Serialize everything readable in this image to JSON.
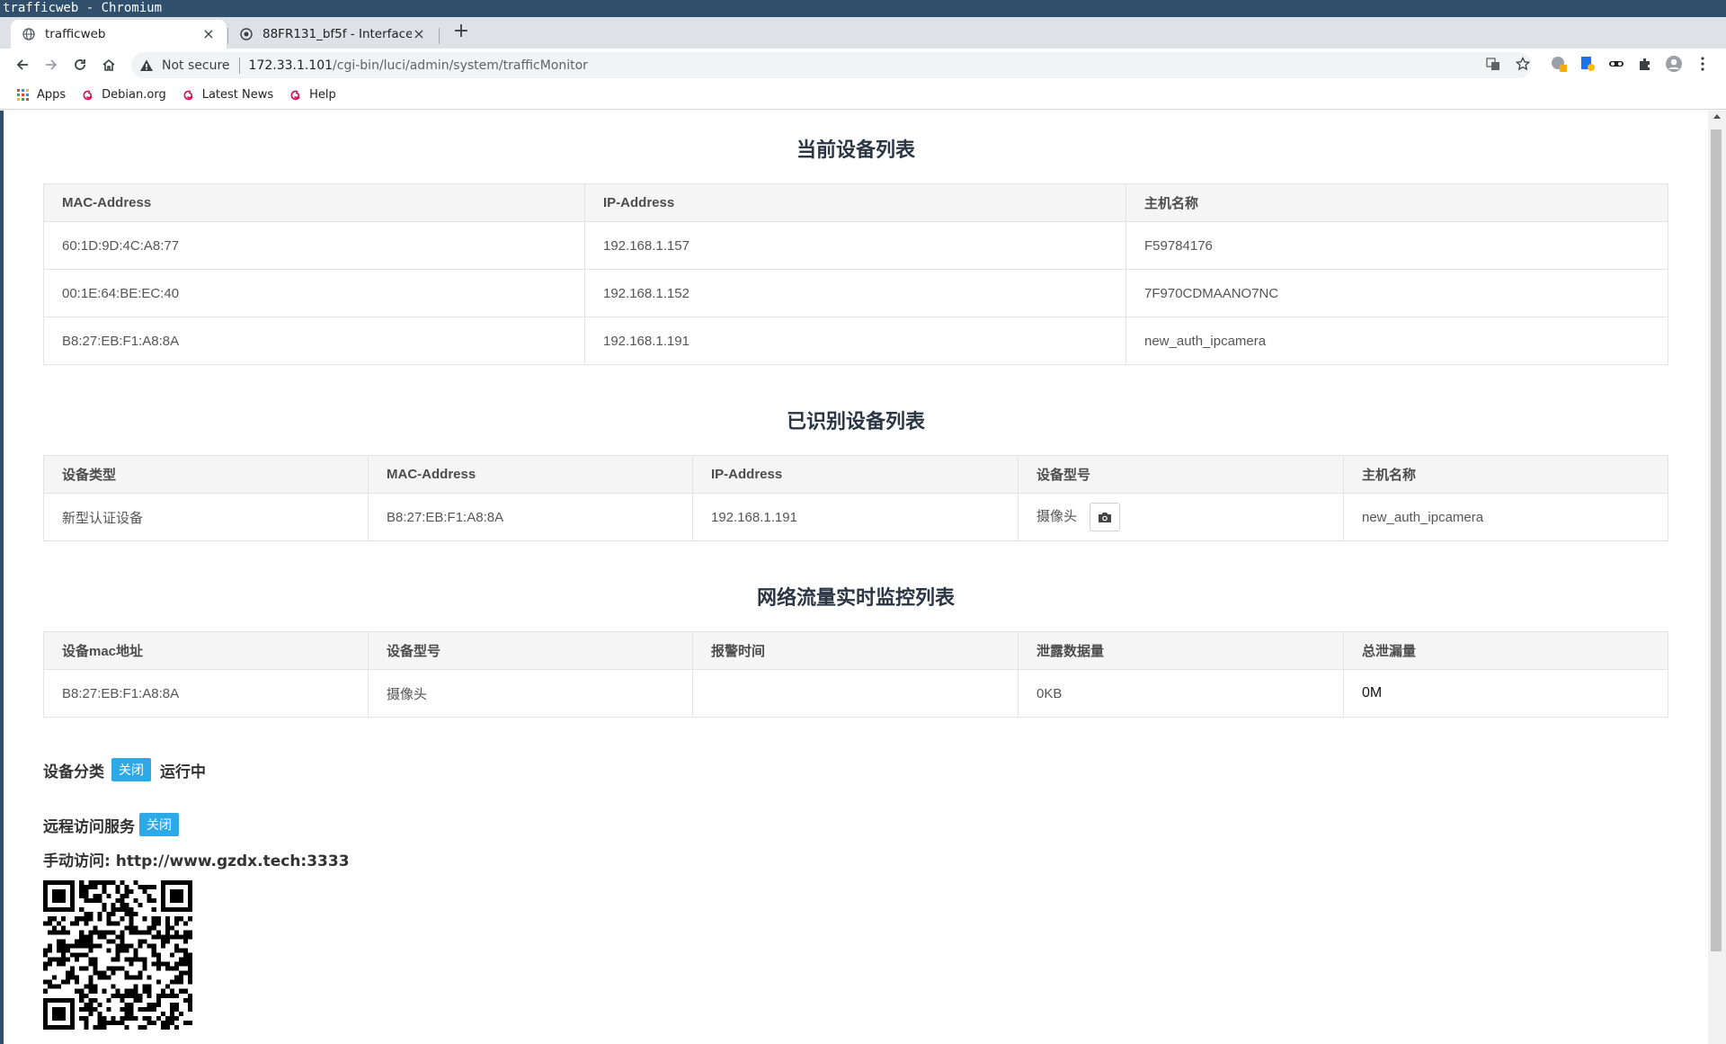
{
  "window": {
    "title": "trafficweb - Chromium"
  },
  "tabs": [
    {
      "title": "trafficweb",
      "active": true
    },
    {
      "title": "88FR131_bf5f - Interfaces",
      "active": false
    }
  ],
  "omnibox": {
    "security_text": "Not secure",
    "url_host": "172.33.1.101",
    "url_path": "/cgi-bin/luci/admin/system/trafficMonitor"
  },
  "bookmarks": [
    {
      "label": "Apps"
    },
    {
      "label": "Debian.org"
    },
    {
      "label": "Latest News"
    },
    {
      "label": "Help"
    }
  ],
  "current_devices": {
    "title": "当前设备列表",
    "headers": [
      "MAC-Address",
      "IP-Address",
      "主机名称"
    ],
    "rows": [
      [
        "60:1D:9D:4C:A8:77",
        "192.168.1.157",
        "F59784176"
      ],
      [
        "00:1E:64:BE:EC:40",
        "192.168.1.152",
        "7F970CDMAANO7NC"
      ],
      [
        "B8:27:EB:F1:A8:8A",
        "192.168.1.191",
        "new_auth_ipcamera"
      ]
    ]
  },
  "identified_devices": {
    "title": "已识别设备列表",
    "headers": [
      "设备类型",
      "MAC-Address",
      "IP-Address",
      "设备型号",
      "主机名称"
    ],
    "rows": [
      [
        "新型认证设备",
        "B8:27:EB:F1:A8:8A",
        "192.168.1.191",
        "摄像头",
        "new_auth_ipcamera"
      ]
    ]
  },
  "traffic_monitor": {
    "title": "网络流量实时监控列表",
    "headers": [
      "设备mac地址",
      "设备型号",
      "报警时间",
      "泄露数据量",
      "总泄漏量"
    ],
    "rows": [
      [
        "B8:27:EB:F1:A8:8A",
        "摄像头",
        "",
        "0KB",
        "0M"
      ]
    ]
  },
  "device_classification": {
    "label": "设备分类",
    "badge": "关闭",
    "status": "运行中"
  },
  "remote_access": {
    "label": "远程访问服务",
    "badge": "关闭",
    "manual": "手动访问: http://www.gzdx.tech:3333"
  },
  "colors": {
    "badge": "#2ea9e8",
    "titlebar": "#2f4f6d",
    "heading": "#2b3644"
  }
}
